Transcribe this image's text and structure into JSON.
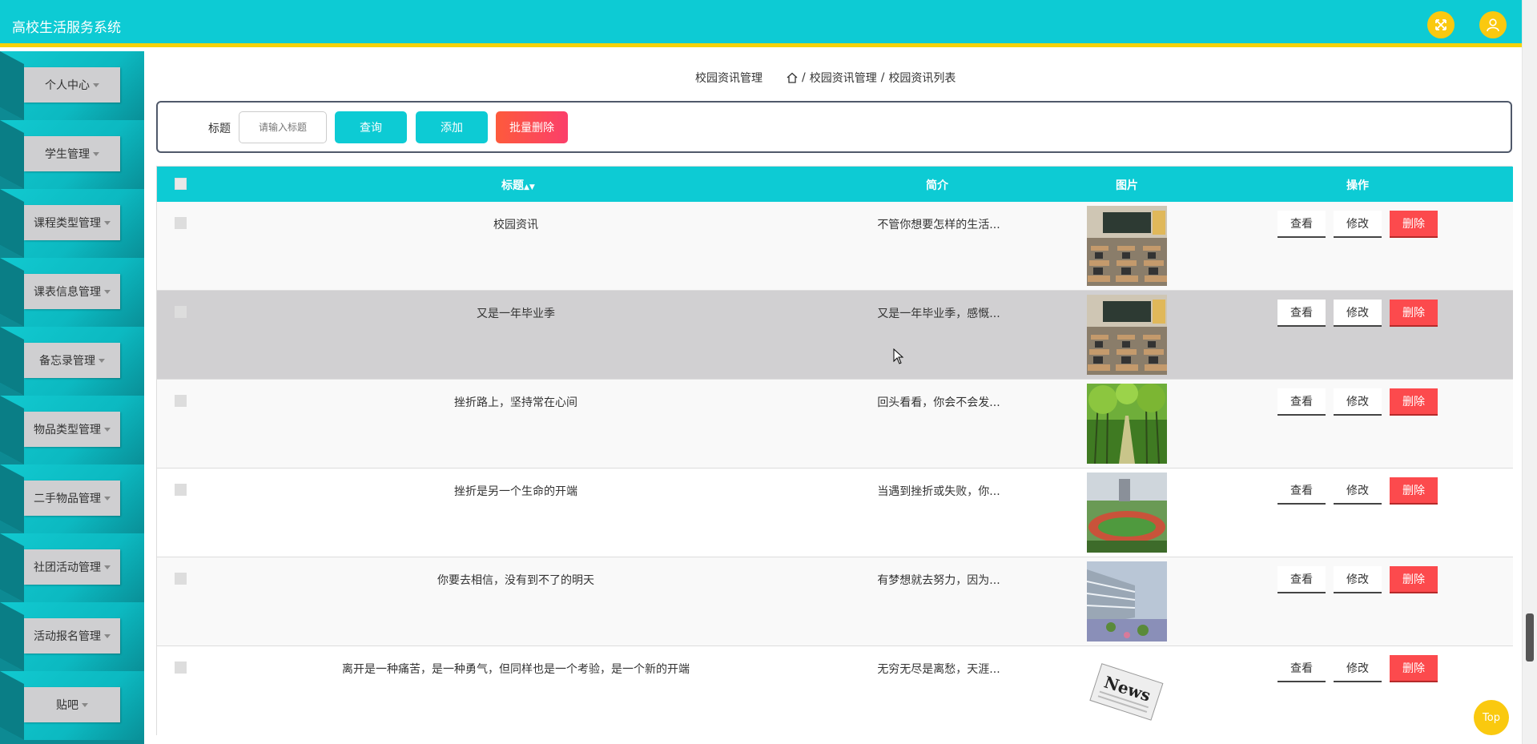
{
  "header": {
    "app_title": "高校生活服务系统",
    "icons": [
      "fullscreen-icon",
      "user-icon"
    ],
    "bg_color": "#0dcbd4",
    "accent_color": "#fac90f"
  },
  "sidebar": {
    "items": [
      {
        "label": "个人中心"
      },
      {
        "label": "学生管理"
      },
      {
        "label": "课程类型管理"
      },
      {
        "label": "课表信息管理"
      },
      {
        "label": "备忘录管理"
      },
      {
        "label": "物品类型管理"
      },
      {
        "label": "二手物品管理"
      },
      {
        "label": "社团活动管理"
      },
      {
        "label": "活动报名管理"
      },
      {
        "label": "贴吧"
      }
    ]
  },
  "breadcrumb": {
    "page_title": "校园资讯管理",
    "crumbs": [
      "校园资讯管理",
      "校园资讯列表"
    ],
    "separator": "/"
  },
  "search": {
    "label": "标题",
    "placeholder": "请输入标题",
    "query_button": "查询",
    "add_button": "添加",
    "batch_delete_button": "批量删除"
  },
  "table": {
    "headers": {
      "title": "标题",
      "intro": "简介",
      "image": "图片",
      "actions": "操作"
    },
    "actions": {
      "view": "查看",
      "edit": "修改",
      "delete": "删除"
    },
    "rows": [
      {
        "title": "校园资讯",
        "intro": "不管你想要怎样的生活...",
        "image": "classroom"
      },
      {
        "title": "又是一年毕业季",
        "intro": "又是一年毕业季，感慨...",
        "image": "classroom"
      },
      {
        "title": "挫折路上，坚持常在心间",
        "intro": "回头看看，你会不会发...",
        "image": "park"
      },
      {
        "title": "挫折是另一个生命的开端",
        "intro": "当遇到挫折或失败，你...",
        "image": "track"
      },
      {
        "title": "你要去相信，没有到不了的明天",
        "intro": "有梦想就去努力，因为...",
        "image": "campus"
      },
      {
        "title": "离开是一种痛苦，是一种勇气，但同样也是一个考验，是一个新的开端",
        "intro": "无穷无尽是离愁，天涯...",
        "image": "news"
      }
    ]
  },
  "top_button": "Top"
}
